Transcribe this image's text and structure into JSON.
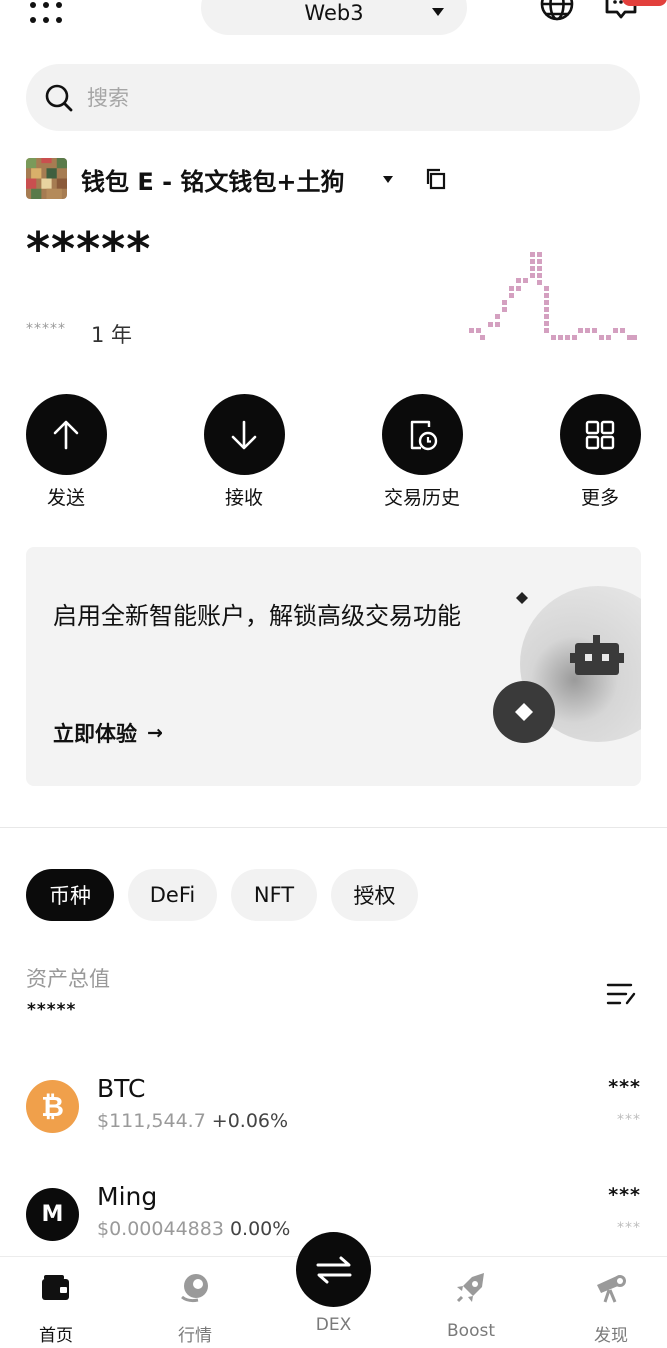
{
  "header": {
    "network_label": "Web3",
    "menu_icon": "grid-dots-icon",
    "globe_icon": "globe-icon",
    "message_icon": "message-icon"
  },
  "search": {
    "placeholder": "搜索"
  },
  "wallet": {
    "name": "钱包 E - 铭文钱包+土狗",
    "balance_masked": "*****",
    "pnl_masked": "*****",
    "period": "1 年"
  },
  "actions": [
    {
      "label": "发送",
      "icon": "arrow-up-icon"
    },
    {
      "label": "接收",
      "icon": "arrow-down-icon"
    },
    {
      "label": "交易历史",
      "icon": "history-icon"
    },
    {
      "label": "更多",
      "icon": "grid-icon"
    }
  ],
  "promo": {
    "title": "启用全新智能账户，解锁高级交易功能",
    "cta": "立即体验",
    "cta_arrow": "→"
  },
  "tabs": [
    {
      "label": "币种",
      "active": true
    },
    {
      "label": "DeFi",
      "active": false
    },
    {
      "label": "NFT",
      "active": false
    },
    {
      "label": "授权",
      "active": false
    }
  ],
  "portfolio": {
    "total_label": "资产总值",
    "total_value_masked": "*****"
  },
  "assets": [
    {
      "symbol": "BTC",
      "logo_letter": "₿",
      "logo_color": "#f0a04b",
      "price": "$111,544.7",
      "change": "+0.06%",
      "amount_masked": "***",
      "value_masked": "***"
    },
    {
      "symbol": "Ming",
      "logo_letter": "M",
      "logo_color": "#0b0b0b",
      "price": "$0.00044883",
      "change": "0.00%",
      "amount_masked": "***",
      "value_masked": "***"
    }
  ],
  "bottom_nav": [
    {
      "label": "首页",
      "icon": "wallet-icon",
      "active": true
    },
    {
      "label": "行情",
      "icon": "market-icon",
      "active": false
    },
    {
      "label": "DEX",
      "icon": "swap-icon",
      "active": false
    },
    {
      "label": "Boost",
      "icon": "rocket-icon",
      "active": false
    },
    {
      "label": "发现",
      "icon": "telescope-icon",
      "active": false
    }
  ],
  "colors": {
    "primary": "#0b0b0b",
    "muted": "#9a9a9a",
    "surface": "#f2f2f2",
    "sparkline": "#d4a0c0",
    "btc": "#f0a04b",
    "badge": "#e2403c"
  }
}
